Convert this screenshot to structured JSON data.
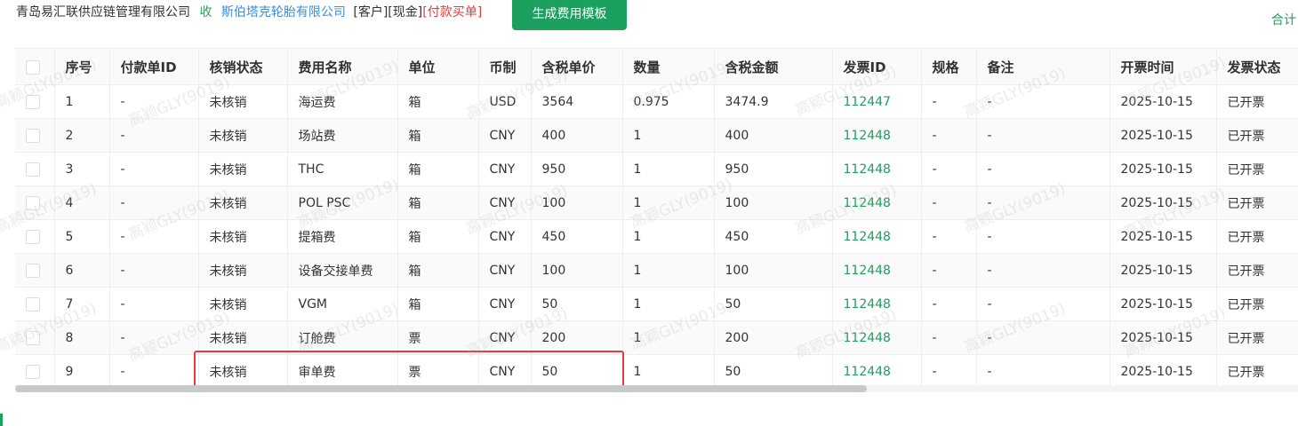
{
  "header": {
    "company": "青岛易汇联供应链管理有限公司",
    "direction": "收",
    "partner": "斯伯塔克轮胎有限公司",
    "type": "[客户]",
    "payment": "[现金]",
    "action": "[付款买单]",
    "generate_button": "生成费用模板",
    "total_link": "合计"
  },
  "table": {
    "columns": [
      "",
      "序号",
      "付款单ID",
      "核销状态",
      "费用名称",
      "单位",
      "币制",
      "含税单价",
      "数量",
      "含税金额",
      "发票ID",
      "规格",
      "备注",
      "开票时间",
      "发票状态"
    ],
    "rows": [
      {
        "seq": "1",
        "pay_id": "-",
        "status": "未核销",
        "name": "海运费",
        "unit": "箱",
        "currency": "USD",
        "price": "3564",
        "qty": "0.975",
        "amount": "3474.9",
        "invoice": "112447",
        "spec": "-",
        "remark": "-",
        "date": "2025-10-15",
        "inv_status": "已开票"
      },
      {
        "seq": "2",
        "pay_id": "-",
        "status": "未核销",
        "name": "场站费",
        "unit": "箱",
        "currency": "CNY",
        "price": "400",
        "qty": "1",
        "amount": "400",
        "invoice": "112448",
        "spec": "-",
        "remark": "-",
        "date": "2025-10-15",
        "inv_status": "已开票"
      },
      {
        "seq": "3",
        "pay_id": "-",
        "status": "未核销",
        "name": "THC",
        "unit": "箱",
        "currency": "CNY",
        "price": "950",
        "qty": "1",
        "amount": "950",
        "invoice": "112448",
        "spec": "-",
        "remark": "-",
        "date": "2025-10-15",
        "inv_status": "已开票"
      },
      {
        "seq": "4",
        "pay_id": "-",
        "status": "未核销",
        "name": "POL PSC",
        "unit": "箱",
        "currency": "CNY",
        "price": "100",
        "qty": "1",
        "amount": "100",
        "invoice": "112448",
        "spec": "-",
        "remark": "-",
        "date": "2025-10-15",
        "inv_status": "已开票"
      },
      {
        "seq": "5",
        "pay_id": "-",
        "status": "未核销",
        "name": "提箱费",
        "unit": "箱",
        "currency": "CNY",
        "price": "450",
        "qty": "1",
        "amount": "450",
        "invoice": "112448",
        "spec": "-",
        "remark": "-",
        "date": "2025-10-15",
        "inv_status": "已开票"
      },
      {
        "seq": "6",
        "pay_id": "-",
        "status": "未核销",
        "name": "设备交接单费",
        "unit": "箱",
        "currency": "CNY",
        "price": "100",
        "qty": "1",
        "amount": "100",
        "invoice": "112448",
        "spec": "-",
        "remark": "-",
        "date": "2025-10-15",
        "inv_status": "已开票"
      },
      {
        "seq": "7",
        "pay_id": "-",
        "status": "未核销",
        "name": "VGM",
        "unit": "箱",
        "currency": "CNY",
        "price": "50",
        "qty": "1",
        "amount": "50",
        "invoice": "112448",
        "spec": "-",
        "remark": "-",
        "date": "2025-10-15",
        "inv_status": "已开票"
      },
      {
        "seq": "8",
        "pay_id": "-",
        "status": "未核销",
        "name": "订舱费",
        "unit": "票",
        "currency": "CNY",
        "price": "200",
        "qty": "1",
        "amount": "200",
        "invoice": "112448",
        "spec": "-",
        "remark": "-",
        "date": "2025-10-15",
        "inv_status": "已开票"
      },
      {
        "seq": "9",
        "pay_id": "-",
        "status": "未核销",
        "name": "审单费",
        "unit": "票",
        "currency": "CNY",
        "price": "50",
        "qty": "1",
        "amount": "50",
        "invoice": "112448",
        "spec": "-",
        "remark": "-",
        "date": "2025-10-15",
        "inv_status": "已开票"
      }
    ]
  },
  "watermark": "高颖GLY(9019)",
  "colors": {
    "accent": "#1ca05f",
    "highlight": "#e23d3d",
    "link": "#3a8ee6",
    "danger": "#e83a3a"
  }
}
